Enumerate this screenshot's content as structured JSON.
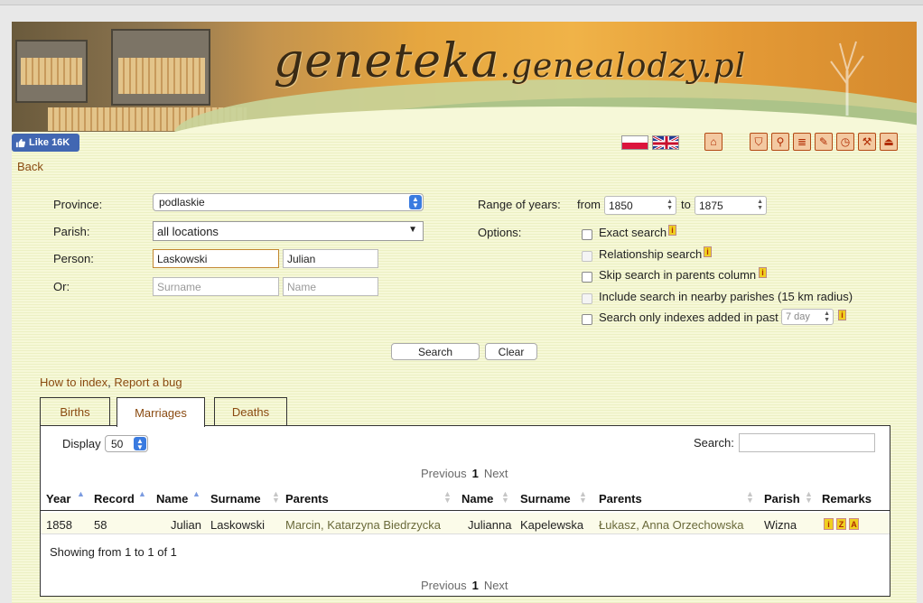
{
  "header": {
    "logo_main": "geneteka",
    "logo_domain": ".genealodzy.pl",
    "like_label": "Like 16K"
  },
  "nav": {
    "back": "Back",
    "tools": [
      "home-icon",
      "shield-icon",
      "search-icon",
      "list-icon",
      "edit-icon",
      "clock-icon",
      "wrench-icon",
      "exit-icon"
    ]
  },
  "form": {
    "province_label": "Province:",
    "province_value": "podlaskie",
    "parish_label": "Parish:",
    "parish_value": "all locations",
    "person_label": "Person:",
    "person_surname": "Laskowski",
    "person_name": "Julian",
    "or_label": "Or:",
    "or_surname_placeholder": "Surname",
    "or_name_placeholder": "Name",
    "range_label": "Range of years:",
    "from_label": "from",
    "from_value": "1850",
    "to_label": "to",
    "to_value": "1875",
    "options_label": "Options:",
    "options": [
      {
        "label": "Exact search",
        "disabled": false,
        "info": true
      },
      {
        "label": "Relationship search",
        "disabled": true,
        "info": true
      },
      {
        "label": "Skip search in parents column",
        "disabled": false,
        "info": true
      },
      {
        "label": "Include search in nearby parishes (15 km radius)",
        "disabled": true,
        "info": false
      },
      {
        "label": "Search only indexes added in past",
        "disabled": false,
        "info": true
      }
    ],
    "past_value": "7 day",
    "search_button": "Search",
    "clear_button": "Clear"
  },
  "links": {
    "how_to_index": "How to index",
    "separator": ",",
    "report_bug": "Report a bug"
  },
  "tabs": [
    {
      "label": "Births",
      "active": false
    },
    {
      "label": "Marriages",
      "active": true
    },
    {
      "label": "Deaths",
      "active": false
    }
  ],
  "table": {
    "display_label": "Display",
    "display_value": "50",
    "search_label": "Search:",
    "pager": {
      "previous": "Previous",
      "page": "1",
      "next": "Next"
    },
    "columns": [
      "Year",
      "Record",
      "Name",
      "Surname",
      "Parents",
      "Name",
      "Surname",
      "Parents",
      "Parish",
      "Remarks"
    ],
    "rows": [
      {
        "year": "1858",
        "record": "58",
        "name": "Julian",
        "surname": "Laskowski",
        "parents": "Marcin, Katarzyna Biedrzycka",
        "name2": "Julianna",
        "surname2": "Kapelewska",
        "parents2": "Łukasz, Anna Orzechowska",
        "parish": "Wizna",
        "remarks": [
          "i",
          "Z",
          "A"
        ]
      }
    ],
    "showing": "Showing from 1 to 1 of 1"
  },
  "colors": {
    "page_bg": "#f6f8d8",
    "link": "#8a4a10",
    "accent": "#3a7be0"
  }
}
